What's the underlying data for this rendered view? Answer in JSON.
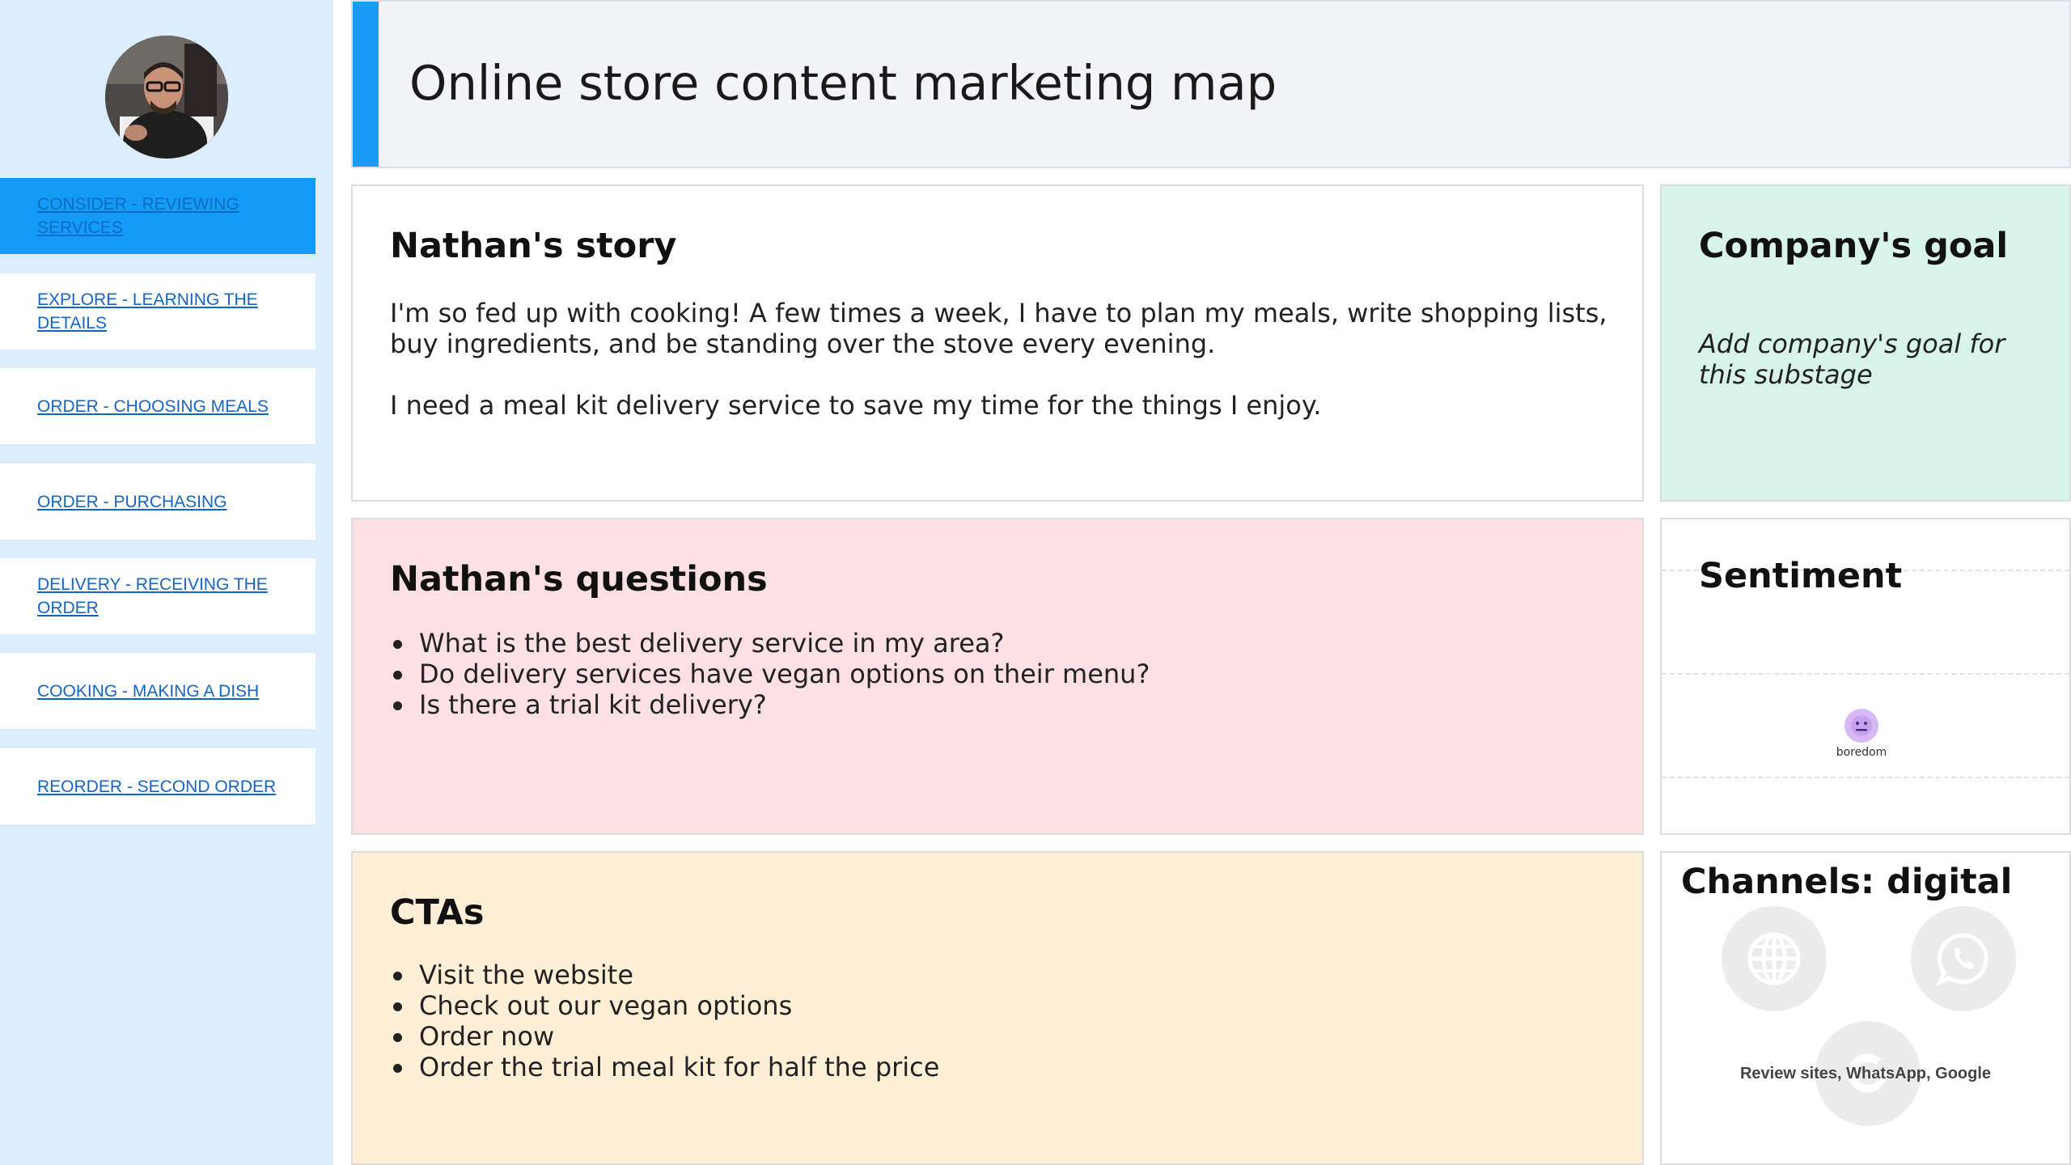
{
  "colors": {
    "sidebar_bg": "#dcedfb",
    "active_nav": "#139bf7",
    "link": "#1565c8",
    "accent": "#1a9bf5",
    "questions_bg": "#fde0e3",
    "ctas_bg": "#ffefd6",
    "goal_bg": "#d7f3ea",
    "sentiment_face": "#d7b9f5"
  },
  "header": {
    "title": "Online store content marketing map"
  },
  "sidebar": {
    "avatar_icon": "person-photo",
    "items": [
      {
        "label": "CONSIDER - REVIEWING SERVICES",
        "active": true
      },
      {
        "label": "EXPLORE - LEARNING THE DETAILS",
        "active": false
      },
      {
        "label": "ORDER - CHOOSING MEALS",
        "active": false
      },
      {
        "label": "ORDER - PURCHASING",
        "active": false
      },
      {
        "label": "DELIVERY - RECEIVING THE ORDER",
        "active": false
      },
      {
        "label": "COOKING - MAKING A DISH",
        "active": false
      },
      {
        "label": "REORDER - SECOND ORDER",
        "active": false
      }
    ]
  },
  "story": {
    "title": "Nathan's story",
    "paragraphs": [
      "I'm so fed up with cooking! A few times a week, I have to plan my meals, write shopping lists, buy ingredients, and be standing over the stove every evening.",
      "I need a meal kit delivery service to save my time for the things I enjoy."
    ]
  },
  "goal": {
    "title": "Company's goal",
    "text": "Add company's goal for this substage"
  },
  "questions": {
    "title": "Nathan's questions",
    "items": [
      "What is the best delivery service in my area?",
      "Do delivery services have vegan options on their menu?",
      "Is there a trial kit delivery?"
    ]
  },
  "sentiment": {
    "title": "Sentiment",
    "emoji_icon": "neutral-face-icon",
    "label": "boredom"
  },
  "ctas": {
    "title": "CTAs",
    "items": [
      "Visit the website",
      "Check out our vegan options",
      "Order now",
      "Order the trial meal kit for half the price"
    ]
  },
  "channels": {
    "title": "Channels: digital",
    "icons": [
      "globe-icon",
      "whatsapp-icon",
      "google-icon"
    ],
    "caption": "Review sites, WhatsApp, Google"
  }
}
